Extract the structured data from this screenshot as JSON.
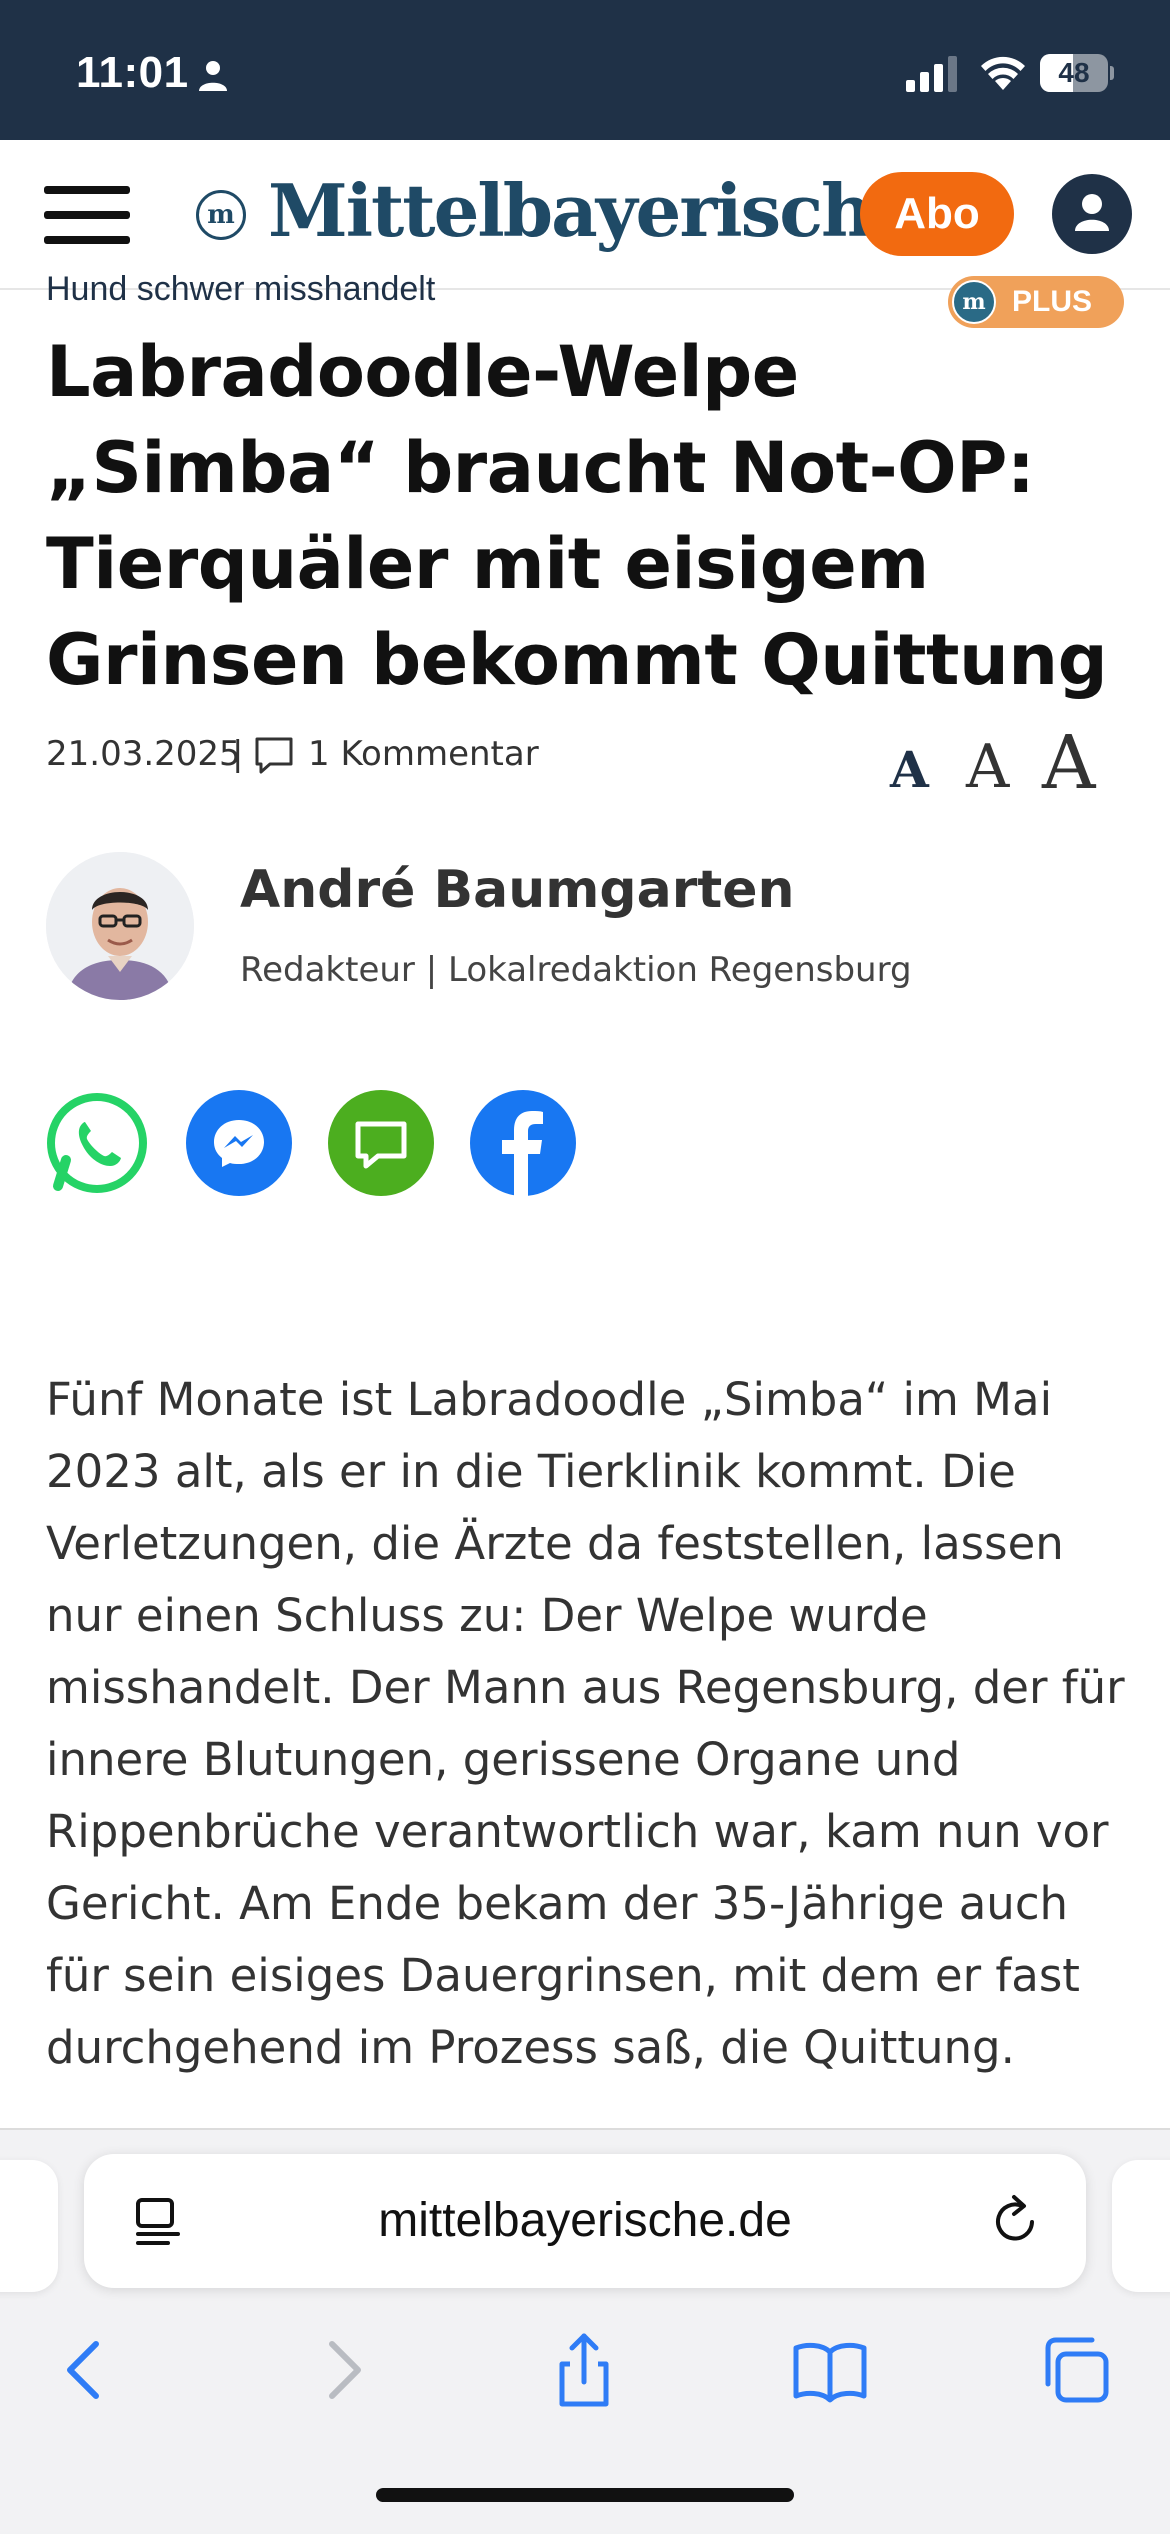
{
  "status_bar": {
    "time": "11:01",
    "battery": "48",
    "battery_level": 0.48
  },
  "header": {
    "logo_mark": "m",
    "logo_text": "Mittelbayerische",
    "abo_label": "Abo"
  },
  "article": {
    "kicker": "Hund schwer misshandelt",
    "plus_badge": "PLUS",
    "headline": "Labradoodle-Welpe „Simba“ braucht Not-OP: Tierquäler mit eisigem Grinsen bekommt Quittung",
    "date": "21.03.2025",
    "separator": "|",
    "comments": "1 Kommentar",
    "font_sizes": [
      "A",
      "A",
      "A"
    ],
    "author": {
      "name": "André Baumgarten",
      "role": "Redakteur | Lokalredaktion Regensburg"
    },
    "body": "Fünf Monate ist Labradoodle „Simba“ im Mai 2023 alt, als er in die Tierklinik kommt. Die Verletzungen, die Ärzte da feststellen, lassen nur einen Schluss zu: Der Welpe wurde misshandelt. Der Mann aus Regensburg, der für innere Blutungen, gerissene Organe und Rippenbrüche verantwortlich war, kam nun vor Gericht. Am Ende bekam der 35-Jährige auch für sein eisiges Dauergrinsen, mit dem er fast durchgehend im Prozess saß, die Quittung."
  },
  "share": {
    "icons": [
      "whatsapp-icon",
      "messenger-icon",
      "sms-icon",
      "facebook-icon"
    ],
    "colors": {
      "messenger": "#1877f2",
      "sms": "#4cae1f",
      "facebook": "#1877f2",
      "whatsapp": "#25d366"
    }
  },
  "browser": {
    "url": "mittelbayerische.de"
  },
  "colors": {
    "status_bar_bg": "#1f3147",
    "logo": "#1f4a66",
    "abo": "#f26a10",
    "ios_blue": "#2f7cf6"
  }
}
